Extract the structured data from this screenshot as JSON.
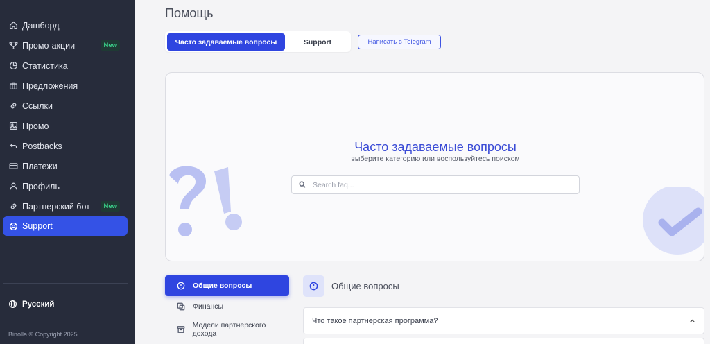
{
  "sidebar": {
    "items": [
      {
        "label": "Дашборд",
        "icon": "home-icon"
      },
      {
        "label": "Промо-акции",
        "icon": "trophy-icon",
        "badge": "New"
      },
      {
        "label": "Статистика",
        "icon": "pie-chart-icon"
      },
      {
        "label": "Предложения",
        "icon": "briefcase-icon"
      },
      {
        "label": "Ссылки",
        "icon": "link-icon"
      },
      {
        "label": "Промо",
        "icon": "image-icon"
      },
      {
        "label": "Postbacks",
        "icon": "reply-arrow-icon"
      },
      {
        "label": "Платежи",
        "icon": "card-icon"
      },
      {
        "label": "Профиль",
        "icon": "user-icon"
      },
      {
        "label": "Партнерский бот",
        "icon": "link-icon",
        "badge": "New"
      },
      {
        "label": "Support",
        "icon": "lifebuoy-icon",
        "active": true
      }
    ],
    "language": "Русский",
    "copyright": "Binolla © Copyright 2025"
  },
  "main": {
    "title": "Помощь",
    "tabs": [
      {
        "label": "Часто задаваемые вопросы",
        "active": true
      },
      {
        "label": "Support"
      }
    ],
    "telegram_button": "Написать в Telegram",
    "hero": {
      "title": "Часто задаваемые вопросы",
      "subtitle": "выберите категорию или воспользуйтесь поиском",
      "search_placeholder": "Search faq..."
    },
    "categories": [
      {
        "label": "Общие вопросы",
        "icon": "info-circle-icon",
        "active": true
      },
      {
        "label": "Финансы",
        "icon": "coins-icon"
      },
      {
        "label": "Модели партнерского дохода",
        "icon": "box-icon"
      }
    ],
    "section": {
      "title": "Общие вопросы",
      "icon": "info-circle-icon"
    },
    "faq_items": [
      {
        "question": "Что такое партнерская программа?",
        "expanded": true
      }
    ]
  },
  "colors": {
    "sidebar_bg": "#272c3b",
    "accent": "#2f45e0",
    "badge_green": "#3ad089",
    "hero_title": "#3a4bd6"
  }
}
